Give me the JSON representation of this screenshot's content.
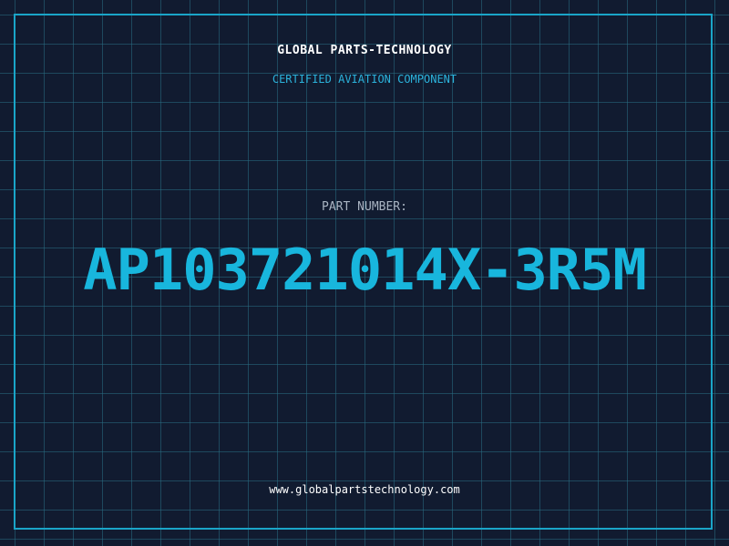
{
  "header": {
    "company_name": "GLOBAL PARTS-TECHNOLOGY",
    "subtitle": "CERTIFIED AVIATION COMPONENT"
  },
  "part": {
    "label": "PART NUMBER:",
    "number": "AP103721014X-3R5M"
  },
  "footer": {
    "website": "www.globalpartstechnology.com"
  },
  "colors": {
    "background": "#111b30",
    "grid": "#286e82",
    "accent": "#18b6dd",
    "text": "#ffffff",
    "label": "#a9b4c2"
  }
}
